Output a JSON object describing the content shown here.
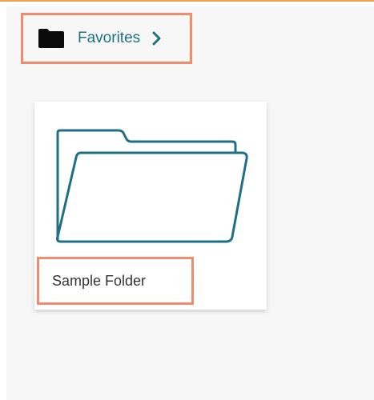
{
  "breadcrumb": {
    "label": "Favorites",
    "icon": "folder-icon",
    "chevron": "chevron-right-icon"
  },
  "folder_card": {
    "name": "Sample Folder",
    "icon": "folder-outline-icon"
  },
  "colors": {
    "accent": "#1f6f86",
    "highlight": "#f08c6e",
    "top_border": "#f0a04b"
  }
}
